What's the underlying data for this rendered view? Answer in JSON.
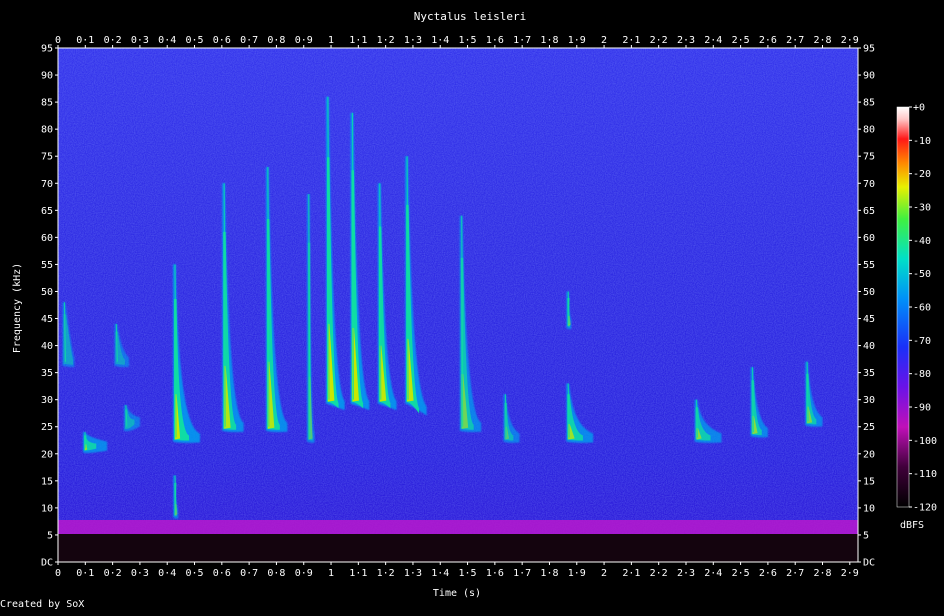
{
  "chart_data": {
    "type": "heatmap",
    "title": "Nyctalus leisleri",
    "xlabel": "Time (s)",
    "ylabel": "Frequency (kHz)",
    "colorbar_label": "dBFS",
    "credit": "Created by SoX",
    "x_range": [
      0,
      2.93
    ],
    "y_range": [
      0,
      95
    ],
    "x_ticks": [
      "0",
      "0·1",
      "0·2",
      "0·3",
      "0·4",
      "0·5",
      "0·6",
      "0·7",
      "0·8",
      "0·9",
      "1",
      "1·1",
      "1·2",
      "1·3",
      "1·4",
      "1·5",
      "1·6",
      "1·7",
      "1·8",
      "1·9",
      "2",
      "2·1",
      "2·2",
      "2·3",
      "2·4",
      "2·5",
      "2·6",
      "2·7",
      "2·8",
      "2·9"
    ],
    "y_ticks": [
      "DC",
      "5",
      "10",
      "15",
      "20",
      "25",
      "30",
      "35",
      "40",
      "45",
      "50",
      "55",
      "60",
      "65",
      "70",
      "75",
      "80",
      "85",
      "90",
      "95"
    ],
    "colorbar_ticks": [
      "+0",
      "-10",
      "-20",
      "-30",
      "-40",
      "-50",
      "-60",
      "-70",
      "-80",
      "-90",
      "-100",
      "-110",
      "-120"
    ],
    "colorbar_range": [
      -120,
      0
    ],
    "colors": {
      "background": "#000000",
      "noise_floor": "#2a1ee0",
      "noise_floor_light": "#3a38f0",
      "low_band": "#c01ad0",
      "call_core": "#c8e800",
      "call_mid": "#10e0a0",
      "call_edge": "#00a0f0"
    },
    "calls": [
      {
        "t_start": 0.02,
        "f_high": 48,
        "f_low": 37,
        "t_end": 0.05,
        "tail_end": 0.06,
        "tail_f": 37,
        "intensity": -85
      },
      {
        "t_start": 0.095,
        "f_high": 24,
        "f_low": 21,
        "t_end": 0.1,
        "tail_end": 0.18,
        "tail_f": 21.5,
        "intensity": -55
      },
      {
        "t_start": 0.21,
        "f_high": 44,
        "f_low": 37,
        "t_end": 0.23,
        "tail_end": 0.26,
        "tail_f": 37,
        "intensity": -85
      },
      {
        "t_start": 0.245,
        "f_high": 29,
        "f_low": 25,
        "t_end": 0.26,
        "tail_end": 0.3,
        "tail_f": 26,
        "intensity": -78
      },
      {
        "t_start": 0.425,
        "f_high": 55,
        "f_low": 23,
        "t_end": 0.44,
        "tail_end": 0.52,
        "tail_f": 23,
        "intensity": -45
      },
      {
        "t_start": 0.425,
        "f_high": 16,
        "f_low": 9,
        "t_end": 0.43,
        "tail_end": 0.44,
        "tail_f": 9,
        "intensity": -70
      },
      {
        "t_start": 0.605,
        "f_high": 70,
        "f_low": 25,
        "t_end": 0.625,
        "tail_end": 0.68,
        "tail_f": 25,
        "intensity": -50
      },
      {
        "t_start": 0.765,
        "f_high": 73,
        "f_low": 25,
        "t_end": 0.785,
        "tail_end": 0.84,
        "tail_f": 25,
        "intensity": -50
      },
      {
        "t_start": 0.915,
        "f_high": 68,
        "f_low": 23,
        "t_end": 0.925,
        "tail_end": 0.94,
        "tail_f": 23,
        "intensity": -72
      },
      {
        "t_start": 0.985,
        "f_high": 86,
        "f_low": 30,
        "t_end": 1.005,
        "tail_end": 1.05,
        "tail_f": 29,
        "intensity": -45
      },
      {
        "t_start": 1.075,
        "f_high": 83,
        "f_low": 30,
        "t_end": 1.095,
        "tail_end": 1.14,
        "tail_f": 29,
        "intensity": -45
      },
      {
        "t_start": 1.175,
        "f_high": 70,
        "f_low": 30,
        "t_end": 1.195,
        "tail_end": 1.24,
        "tail_f": 29,
        "intensity": -47
      },
      {
        "t_start": 1.275,
        "f_high": 75,
        "f_low": 30,
        "t_end": 1.295,
        "tail_end": 1.35,
        "tail_f": 28,
        "intensity": -47
      },
      {
        "t_start": 1.475,
        "f_high": 64,
        "f_low": 25,
        "t_end": 1.495,
        "tail_end": 1.55,
        "tail_f": 25,
        "intensity": -65
      },
      {
        "t_start": 1.635,
        "f_high": 31,
        "f_low": 23,
        "t_end": 1.645,
        "tail_end": 1.69,
        "tail_f": 23,
        "intensity": -72
      },
      {
        "t_start": 1.865,
        "f_high": 50,
        "f_low": 44,
        "t_end": 1.87,
        "tail_end": 1.88,
        "tail_f": 44,
        "intensity": -65
      },
      {
        "t_start": 1.865,
        "f_high": 33,
        "f_low": 23,
        "t_end": 1.885,
        "tail_end": 1.96,
        "tail_f": 23,
        "intensity": -55
      },
      {
        "t_start": 2.335,
        "f_high": 30,
        "f_low": 23,
        "t_end": 2.35,
        "tail_end": 2.43,
        "tail_f": 23,
        "intensity": -60
      },
      {
        "t_start": 2.54,
        "f_high": 36,
        "f_low": 24,
        "t_end": 2.555,
        "tail_end": 2.6,
        "tail_f": 24,
        "intensity": -60
      },
      {
        "t_start": 2.74,
        "f_high": 37,
        "f_low": 26,
        "t_end": 2.755,
        "tail_end": 2.8,
        "tail_f": 26,
        "intensity": -63
      }
    ]
  }
}
